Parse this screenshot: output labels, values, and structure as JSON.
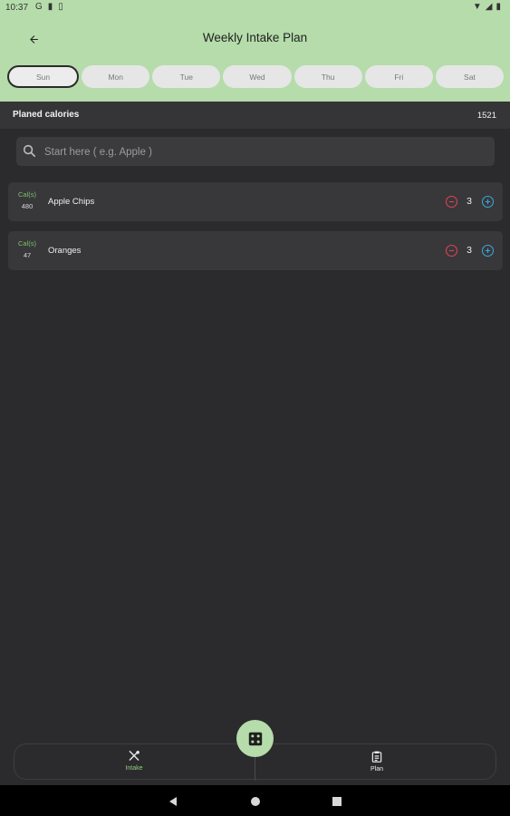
{
  "status_bar": {
    "time": "10:37",
    "left_icons": [
      "google-icon",
      "sim-icon",
      "notification-icon"
    ],
    "right_icons": [
      "wifi-icon",
      "signal-icon",
      "battery-icon"
    ]
  },
  "app_bar": {
    "title": "Weekly Intake Plan"
  },
  "days": [
    {
      "label": "Sun",
      "selected": true
    },
    {
      "label": "Mon",
      "selected": false
    },
    {
      "label": "Tue",
      "selected": false
    },
    {
      "label": "Wed",
      "selected": false
    },
    {
      "label": "Thu",
      "selected": false
    },
    {
      "label": "Fri",
      "selected": false
    },
    {
      "label": "Sat",
      "selected": false
    }
  ],
  "calories": {
    "label": "Planed calories",
    "value": "1521"
  },
  "search": {
    "placeholder": "Start here ( e.g. Apple )"
  },
  "food_items": [
    {
      "cal_label": "Cal(s)",
      "cal_value": "480",
      "name": "Apple Chips",
      "quantity": "3"
    },
    {
      "cal_label": "Cal(s)",
      "cal_value": "47",
      "name": "Oranges",
      "quantity": "3"
    }
  ],
  "bottom_nav": {
    "intake_label": "Intake",
    "plan_label": "Plan"
  },
  "colors": {
    "accent": "#b5dcaa",
    "background": "#2b2b2d",
    "card": "#38383b",
    "minus": "#e0434f",
    "plus": "#3ea6d8",
    "calorie_label": "#7dc16a"
  }
}
